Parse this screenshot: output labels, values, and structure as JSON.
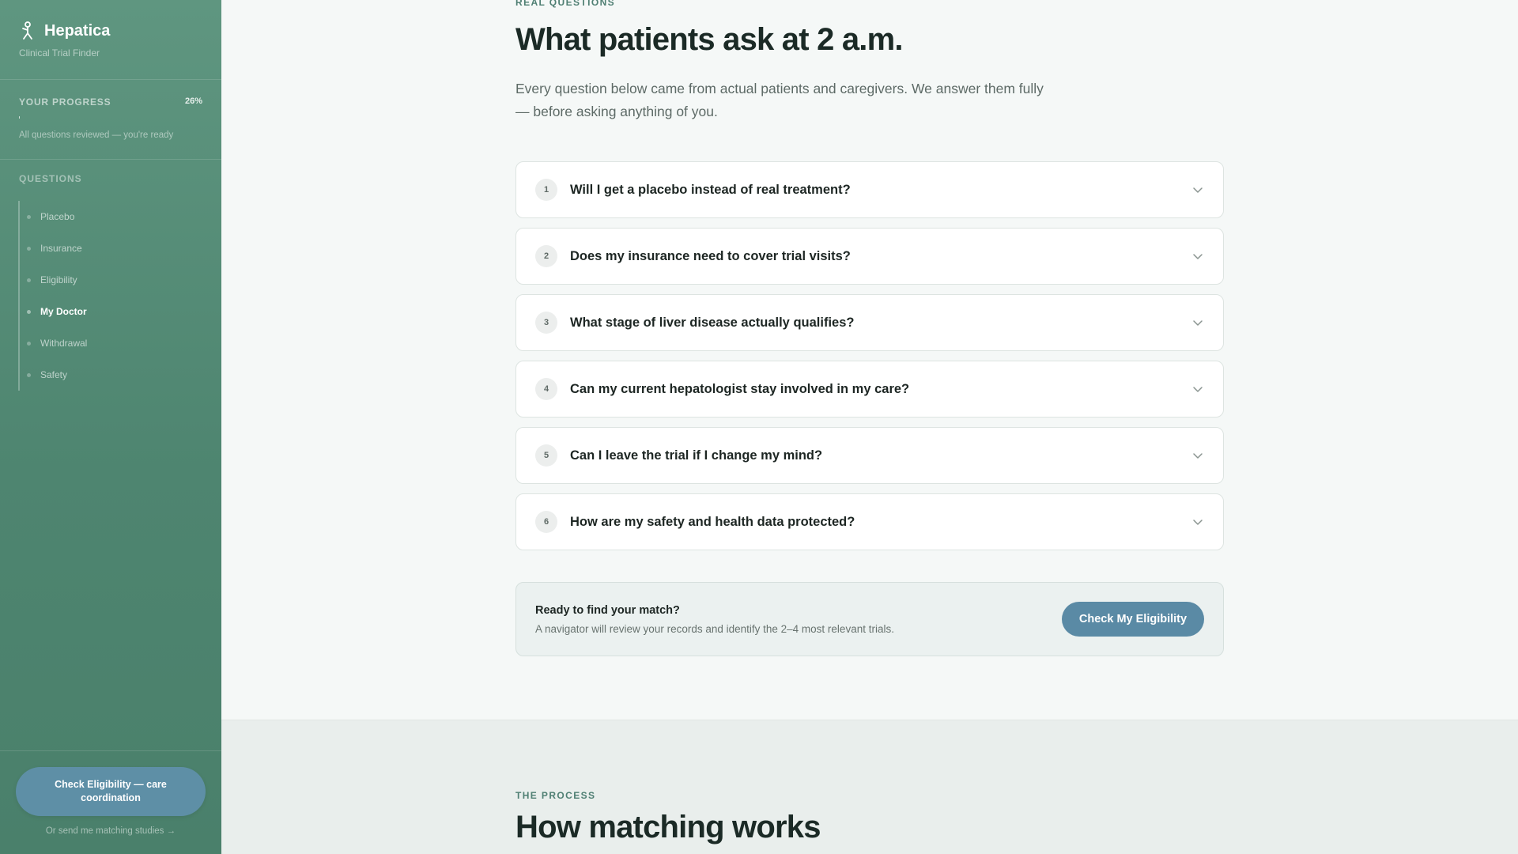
{
  "sidebar": {
    "brand": {
      "title": "Hepatica",
      "subtitle": "Clinical Trial Finder",
      "icon": "figure-icon"
    },
    "progress": {
      "label": "YOUR PROGRESS",
      "value_text": "26%",
      "fill_fraction": 0.004,
      "note": "All questions reviewed — you're ready"
    },
    "questions_label": "QUESTIONS",
    "items": [
      {
        "label": "Placebo",
        "active": false
      },
      {
        "label": "Insurance",
        "active": false
      },
      {
        "label": "Eligibility",
        "active": false
      },
      {
        "label": "My Doctor",
        "active": true
      },
      {
        "label": "Withdrawal",
        "active": false
      },
      {
        "label": "Safety",
        "active": false
      }
    ],
    "cta_label": "Check Eligibility — care coordination",
    "secondary_link": "Or send me matching studies →"
  },
  "main": {
    "eyebrow": "REAL QUESTIONS",
    "title": "What patients ask at 2 a.m.",
    "lead": "Every question below came from actual patients and caregivers. We answer them fully — before asking anything of you.",
    "faqs": [
      {
        "num": "1",
        "question": "Will I get a placebo instead of real treatment?"
      },
      {
        "num": "2",
        "question": "Does my insurance need to cover trial visits?"
      },
      {
        "num": "3",
        "question": "What stage of liver disease actually qualifies?"
      },
      {
        "num": "4",
        "question": "Can my current hepatologist stay involved in my care?"
      },
      {
        "num": "5",
        "question": "Can I leave the trial if I change my mind?"
      },
      {
        "num": "6",
        "question": "How are my safety and health data protected?"
      }
    ],
    "cta": {
      "title": "Ready to find your match?",
      "desc": "A navigator will review your records and identify the 2–4 most relevant trials.",
      "button": "Check My Eligibility"
    }
  },
  "process": {
    "eyebrow": "THE PROCESS",
    "title": "How matching works"
  },
  "colors": {
    "sidebar": "#4e8570",
    "accent_button": "#5a8aa5",
    "eyebrow": "#4f7f73",
    "heading": "#1b2a26"
  }
}
